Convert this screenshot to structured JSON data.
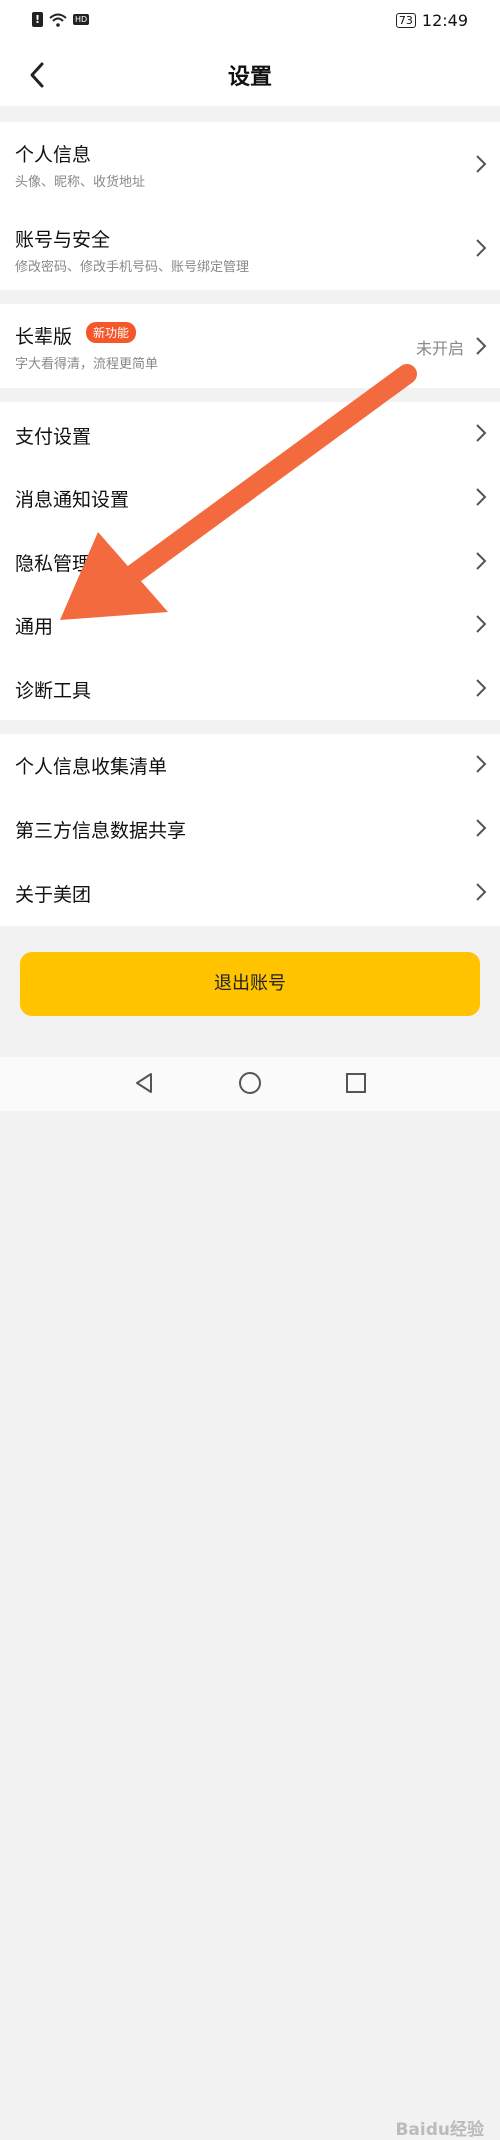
{
  "status_bar": {
    "battery": "73",
    "time": "12:49",
    "network_badge": "HD"
  },
  "header": {
    "title": "设置"
  },
  "groups": {
    "account": [
      {
        "title": "个人信息",
        "subtitle": "头像、昵称、收货地址"
      },
      {
        "title": "账号与安全",
        "subtitle": "修改密码、修改手机号码、账号绑定管理"
      }
    ],
    "elder": {
      "title": "长辈版",
      "badge": "新功能",
      "subtitle": "字大看得清，流程更简单",
      "value": "未开启"
    },
    "settings": [
      {
        "title": "支付设置"
      },
      {
        "title": "消息通知设置"
      },
      {
        "title": "隐私管理"
      },
      {
        "title": "通用"
      },
      {
        "title": "诊断工具"
      }
    ],
    "info": [
      {
        "title": "个人信息收集清单"
      },
      {
        "title": "第三方信息数据共享"
      },
      {
        "title": "关于美团"
      }
    ]
  },
  "logout": {
    "label": "退出账号"
  },
  "watermark": "Baidu经验",
  "icons": {
    "back": "back-arrow-icon",
    "chevron": "chevron-right-icon",
    "annotation": "orange-arrow"
  },
  "colors": {
    "accent": "#ffc300",
    "badge": "#f5572a",
    "annotation_arrow": "#f26a3d"
  }
}
